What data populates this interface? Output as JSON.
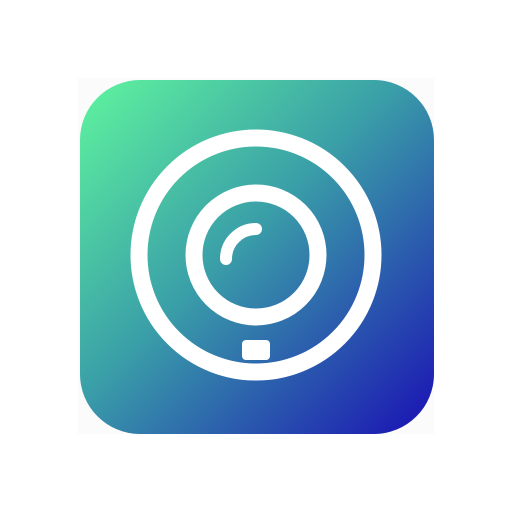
{
  "icon": {
    "name": "magnifier-ring-icon",
    "colors": {
      "gradient_start": "#5ff59e",
      "gradient_mid": "#3a9fa8",
      "gradient_end": "#1a10b4",
      "glyph": "#ffffff",
      "backdrop": "#fbfbfb",
      "page_background": "#ffffff"
    }
  }
}
